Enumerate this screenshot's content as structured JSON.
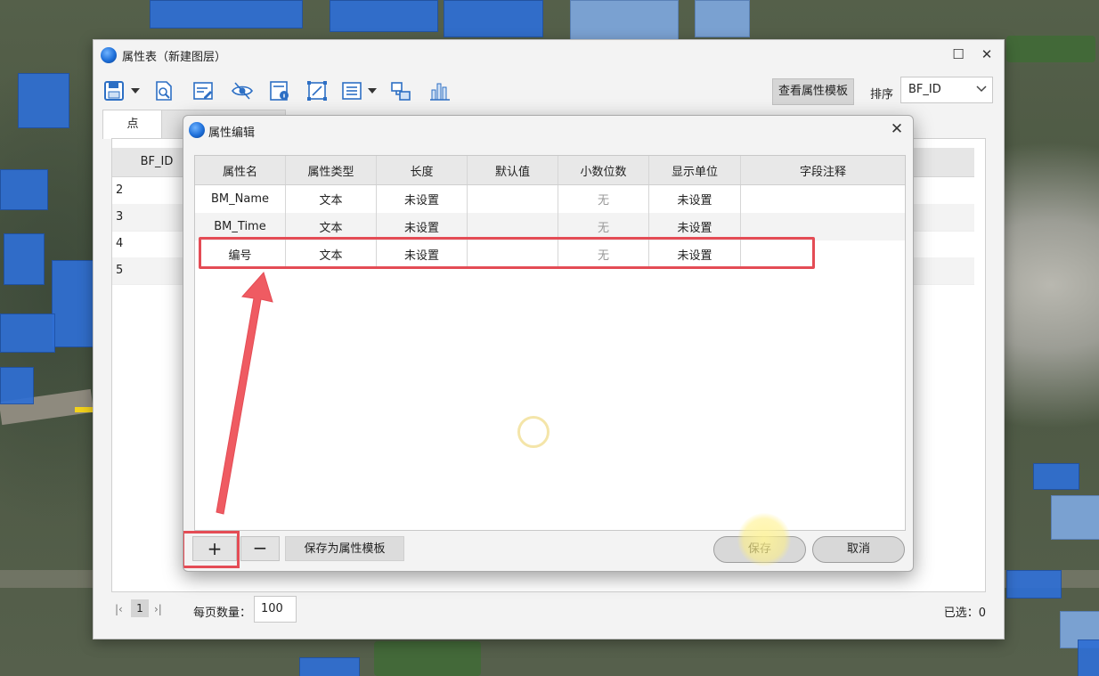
{
  "main_window": {
    "title": "属性表（新建图层）",
    "controls": {
      "maximize": "☐",
      "close": "✕"
    },
    "toolbar": {
      "icons": [
        "save-icon",
        "query-icon",
        "edit-table-icon",
        "visibility-icon",
        "info-icon",
        "frame-icon",
        "list-icon",
        "link-icon",
        "bar-chart-icon"
      ],
      "view_template_label": "查看属性模板",
      "sort_label": "排序",
      "sort_value": "BF_ID"
    },
    "tabs": [
      {
        "label": "点",
        "active": true
      },
      {
        "label": "",
        "active": false
      }
    ],
    "grid": {
      "column": "BF_ID",
      "rows": [
        "2",
        "3",
        "4",
        "5"
      ]
    },
    "pager": {
      "first": "|‹",
      "current_page": "1",
      "last": "›|",
      "per_page_label": "每页数量：",
      "per_page_value": "100",
      "selected_label": "已选：0"
    }
  },
  "dialog": {
    "title": "属性编辑",
    "close": "✕",
    "columns": [
      "属性名",
      "属性类型",
      "长度",
      "默认值",
      "小数位数",
      "显示单位",
      "字段注释"
    ],
    "rows": [
      [
        "BM_Name",
        "文本",
        "未设置",
        "",
        "无",
        "未设置",
        ""
      ],
      [
        "BM_Time",
        "文本",
        "未设置",
        "",
        "无",
        "未设置",
        ""
      ],
      [
        "编号",
        "文本",
        "未设置",
        "",
        "无",
        "未设置",
        ""
      ]
    ],
    "buttons": {
      "add": "+",
      "remove": "−",
      "save_template": "保存为属性模板",
      "save": "保存",
      "cancel": "取消"
    }
  },
  "colors": {
    "highlight": "#e44c55",
    "accent": "#1e6fd9"
  }
}
